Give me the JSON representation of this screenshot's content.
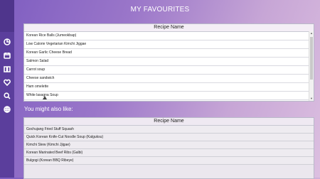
{
  "page": {
    "title": "MY FAVOURITES",
    "suggestions_heading": "You might also like:"
  },
  "favourites": {
    "column_header": "Recipe Name",
    "rows": [
      "Korean Rice Balls (Jumeokbap)",
      "Low Calorie Vegetarian Kimchi Jiggae",
      "Korean Garlic Cheese Bread",
      "Salmon Salad",
      "Carrot soup",
      "Cheese sandwich",
      "Ham omelette",
      "White lasagna Soup"
    ]
  },
  "suggestions": {
    "column_header": "Recipe Name",
    "rows": [
      "Gochujang Fried Stuff Squash",
      "Quick Korean Knife-Cut Noodle Soup (Kalguksu)",
      "Kimchi Stew (Kimchi Jjigae)",
      "Korean Marinated Beef Ribs (Galbi)",
      "Bulgogi (Korean BBQ Ribeye)"
    ]
  },
  "sidebar": {
    "icons": [
      "pie-chart-icon",
      "calendar-icon",
      "book-icon",
      "heart-icon",
      "search-icon",
      "globe-icon"
    ]
  }
}
